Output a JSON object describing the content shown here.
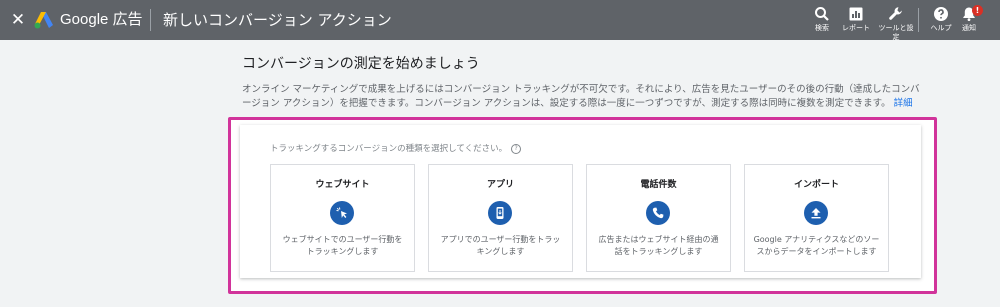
{
  "header": {
    "close_label": "✕",
    "brand": "Google 広告",
    "title": "新しいコンバージョン アクション",
    "tools": [
      {
        "icon": "search-icon",
        "label": "検索"
      },
      {
        "icon": "report-icon",
        "label": "レポート"
      },
      {
        "icon": "wrench-icon",
        "label": "ツールと設定"
      },
      {
        "icon": "help-icon",
        "label": "ヘルプ"
      },
      {
        "icon": "bell-icon",
        "label": "通知",
        "badge": "!"
      }
    ],
    "colors": {
      "bar": "#5f6368",
      "badge": "#d93025"
    }
  },
  "main": {
    "title": "コンバージョンの測定を始めましょう",
    "description": "オンライン マーケティングで成果を上げるにはコンバージョン トラッキングが不可欠です。それにより、広告を見たユーザーのその後の行動（達成したコンバージョン アクション）を把握できます。コンバージョン アクションは、設定する際は一度に一つずつですが、測定する際は同時に複数を測定できます。",
    "details_link": "詳細",
    "prompt": "トラッキングするコンバージョンの種類を選択してください。",
    "help_symbol": "?",
    "highlight_color": "#d1339a",
    "options": [
      {
        "title": "ウェブサイト",
        "icon": "cursor-click-icon",
        "description": "ウェブサイトでのユーザー行動をトラッキングします"
      },
      {
        "title": "アプリ",
        "icon": "mobile-app-icon",
        "description": "アプリでのユーザー行動をトラッキングします"
      },
      {
        "title": "電話件数",
        "icon": "phone-icon",
        "description": "広告またはウェブサイト経由の通話をトラッキングします"
      },
      {
        "title": "インポート",
        "icon": "upload-icon",
        "description": "Google アナリティクスなどのソースからデータをインポートします"
      }
    ],
    "accent": "#1e5faf"
  }
}
